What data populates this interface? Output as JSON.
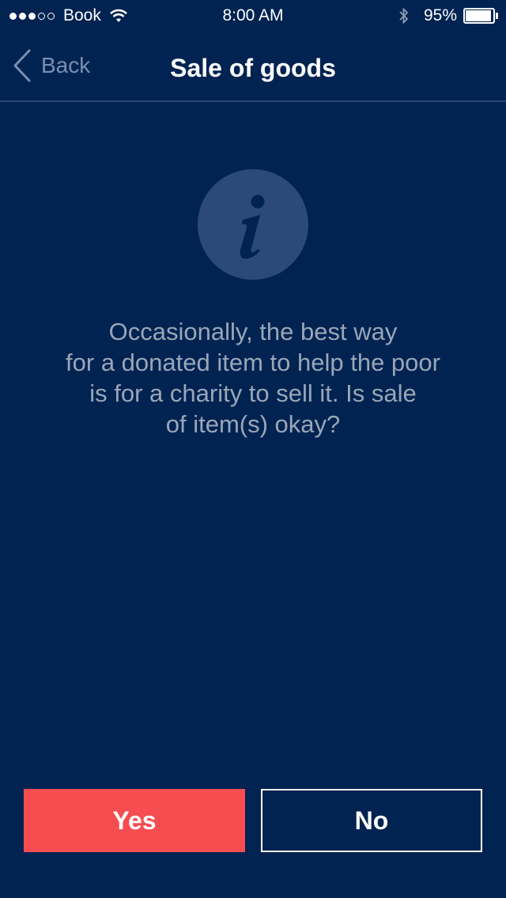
{
  "status_bar": {
    "carrier": "Book",
    "time": "8:00 AM",
    "battery_percent": "95%",
    "battery_level": 0.95,
    "signal_bars_filled": 3,
    "signal_bars_total": 5,
    "icons": [
      "signal-dots-icon",
      "wifi-icon",
      "bluetooth-icon",
      "battery-icon"
    ]
  },
  "nav": {
    "back_label": "Back",
    "title": "Sale of goods",
    "back_icon": "chevron-left-icon"
  },
  "content": {
    "info_icon": "info-icon",
    "message_lines": [
      "Occasionally, the best way",
      "for a donated item to help the poor",
      "is for a charity to sell it. Is sale",
      "of item(s) okay?"
    ]
  },
  "actions": {
    "yes_label": "Yes",
    "no_label": "No"
  },
  "colors": {
    "background": "#012351",
    "accent_yes": "#f54d50",
    "info_circle": "#2b4a79",
    "message_text": "#9aa6b8"
  }
}
